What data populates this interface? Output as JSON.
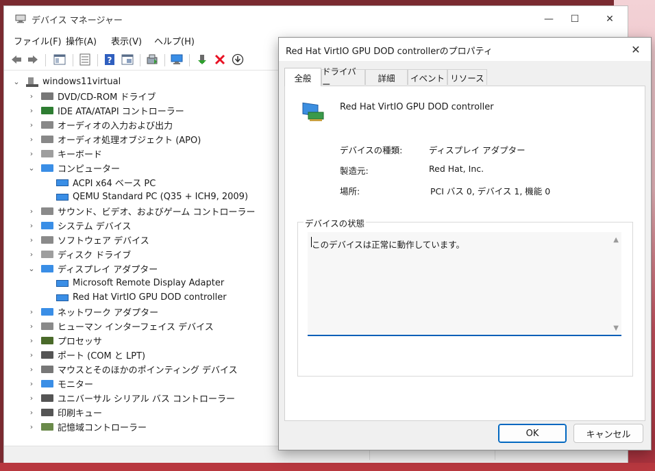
{
  "window": {
    "title": "デバイス マネージャー",
    "minimize": "—",
    "maximize": "☐",
    "close": "✕"
  },
  "menu": [
    "ファイル(F)",
    "操作(A)",
    "表示(V)",
    "ヘルプ(H)"
  ],
  "tree": {
    "root": "windows11virtual",
    "items": [
      {
        "label": "DVD/CD-ROM ドライブ",
        "expanded": false,
        "children": []
      },
      {
        "label": "IDE ATA/ATAPI コントローラー",
        "expanded": false,
        "children": []
      },
      {
        "label": "オーディオの入力および出力",
        "expanded": false,
        "children": []
      },
      {
        "label": "オーディオ処理オブジェクト (APO)",
        "expanded": false,
        "children": []
      },
      {
        "label": "キーボード",
        "expanded": false,
        "children": []
      },
      {
        "label": "コンピューター",
        "expanded": true,
        "children": [
          "ACPI x64 ベース PC",
          "QEMU Standard PC (Q35 + ICH9, 2009)"
        ]
      },
      {
        "label": "サウンド、ビデオ、およびゲーム コントローラー",
        "expanded": false,
        "children": []
      },
      {
        "label": "システム デバイス",
        "expanded": false,
        "children": []
      },
      {
        "label": "ソフトウェア デバイス",
        "expanded": false,
        "children": []
      },
      {
        "label": "ディスク ドライブ",
        "expanded": false,
        "children": []
      },
      {
        "label": "ディスプレイ アダプター",
        "expanded": true,
        "children": [
          "Microsoft Remote Display Adapter",
          "Red Hat VirtIO GPU DOD controller"
        ]
      },
      {
        "label": "ネットワーク アダプター",
        "expanded": false,
        "children": []
      },
      {
        "label": "ヒューマン インターフェイス デバイス",
        "expanded": false,
        "children": []
      },
      {
        "label": "プロセッサ",
        "expanded": false,
        "children": []
      },
      {
        "label": "ポート (COM と LPT)",
        "expanded": false,
        "children": []
      },
      {
        "label": "マウスとそのほかのポインティング デバイス",
        "expanded": false,
        "children": []
      },
      {
        "label": "モニター",
        "expanded": false,
        "children": []
      },
      {
        "label": "ユニバーサル シリアル バス コントローラー",
        "expanded": false,
        "children": []
      },
      {
        "label": "印刷キュー",
        "expanded": false,
        "children": []
      },
      {
        "label": "記憶域コントローラー",
        "expanded": false,
        "children": []
      }
    ]
  },
  "dialog": {
    "title": "Red Hat VirtIO GPU DOD controllerのプロパティ",
    "close": "✕",
    "tabs": [
      "全般",
      "ドライバー",
      "詳細",
      "イベント",
      "リソース"
    ],
    "device_name": "Red Hat VirtIO GPU DOD controller",
    "props": [
      {
        "label": "デバイスの種類:",
        "value": "ディスプレイ アダプター"
      },
      {
        "label": "製造元:",
        "value": "Red Hat, Inc."
      },
      {
        "label": "場所:",
        "value": "PCI バス 0, デバイス 1, 機能 0"
      }
    ],
    "status_group_label": "デバイスの状態",
    "status_text": "このデバイスは正常に動作しています。",
    "scroll_up": "▲",
    "scroll_down": "▼",
    "ok_label": "OK",
    "cancel_label": "キャンセル"
  },
  "colors": {
    "accent": "#005fb8",
    "error": "#e81123"
  }
}
